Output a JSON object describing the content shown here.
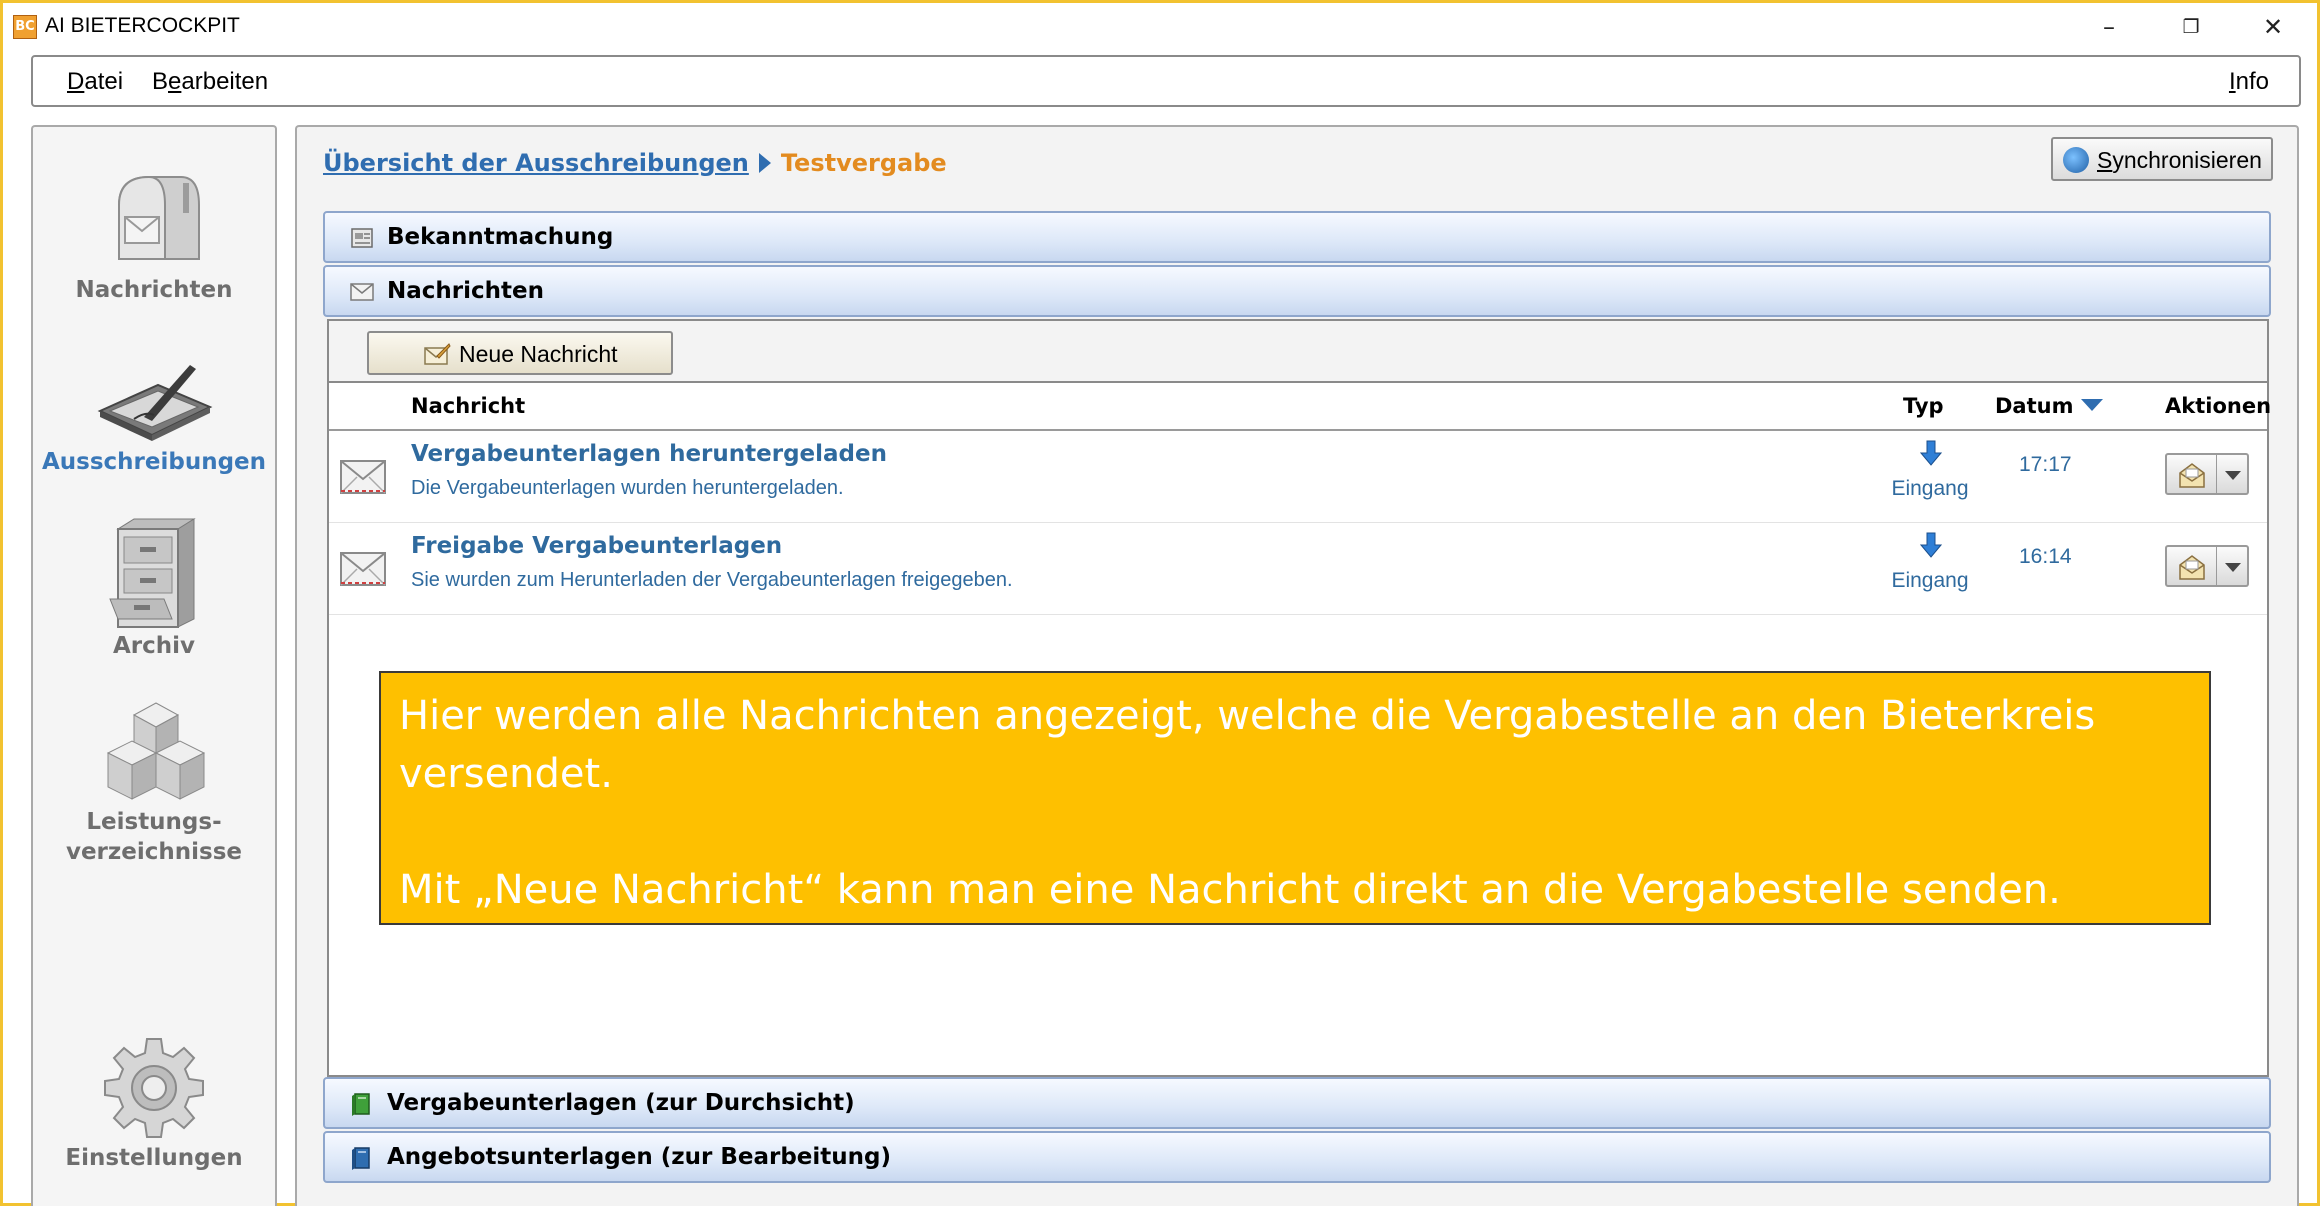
{
  "window": {
    "app_icon_text": "BC",
    "title": "AI BIETERCOCKPIT",
    "minimize": "–",
    "maximize": "❐",
    "close": "✕"
  },
  "menubar": {
    "datei": {
      "underlined": "D",
      "rest": "atei"
    },
    "bearbeiten": {
      "first": "B",
      "underlined": "e",
      "rest": "arbeiten"
    },
    "info": {
      "underlined": "I",
      "rest": "nfo"
    }
  },
  "sidebar": {
    "items": [
      {
        "label": "Nachrichten",
        "icon": "mailbox-icon",
        "active": false
      },
      {
        "label": "Ausschreibungen",
        "icon": "tablet-pen-icon",
        "active": true
      },
      {
        "label": "Archiv",
        "icon": "filing-cabinet-icon",
        "active": false
      },
      {
        "label": "Leistungs-",
        "label2": "verzeichnisse",
        "icon": "cubes-icon",
        "active": false
      },
      {
        "label": "Einstellungen",
        "icon": "gear-icon",
        "active": false
      }
    ]
  },
  "breadcrumb": {
    "link": "Übersicht der Ausschreibungen",
    "current": "Testvergabe"
  },
  "sync_button": {
    "underlined": "S",
    "rest": "ynchronisieren"
  },
  "sections": {
    "bekanntmachung": "Bekanntmachung",
    "nachrichten": "Nachrichten",
    "vergabeunterlagen": "Vergabeunterlagen (zur Durchsicht)",
    "angebotsunterlagen": "Angebotsunterlagen (zur Bearbeitung)"
  },
  "new_message_button": "Neue Nachricht",
  "table": {
    "headers": {
      "nachricht": "Nachricht",
      "typ": "Typ",
      "datum": "Datum",
      "aktionen": "Aktionen"
    },
    "rows": [
      {
        "title": "Vergabeunterlagen heruntergeladen",
        "description": "Die Vergabeunterlagen wurden heruntergeladen.",
        "typ": "Eingang",
        "time": "17:17"
      },
      {
        "title": "Freigabe Vergabeunterlagen",
        "description": "Sie wurden zum Herunterladen der Vergabeunterlagen freigegeben.",
        "typ": "Eingang",
        "time": "16:14"
      }
    ]
  },
  "callout": {
    "line1": "Hier werden alle Nachrichten angezeigt, welche die Vergabestelle an den Bieterkreis",
    "line2": "versendet.",
    "line3": "Mit „Neue Nachricht“ kann man eine Nachricht direkt an die Vergabestelle senden."
  },
  "colors": {
    "window_border": "#f2c230",
    "link_blue": "#2f6db0",
    "breadcrumb_current": "#e38b1f",
    "callout_bg": "#fec000",
    "section_gradient": "#dde8f8"
  }
}
